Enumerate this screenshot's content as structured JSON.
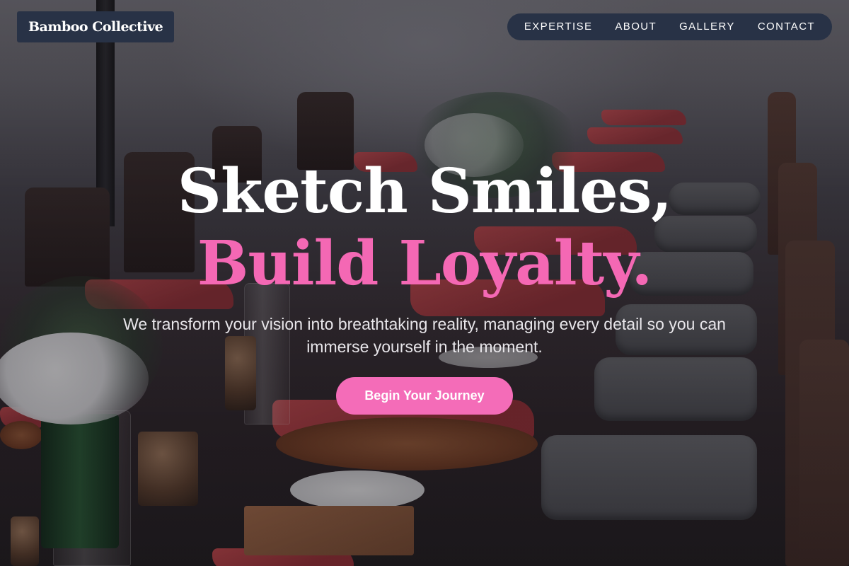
{
  "header": {
    "brand": "Bamboo Collective",
    "nav": {
      "items": [
        {
          "label": "EXPERTISE"
        },
        {
          "label": "ABOUT"
        },
        {
          "label": "GALLERY"
        },
        {
          "label": "CONTACT"
        }
      ]
    }
  },
  "hero": {
    "headline_line1": "Sketch Smiles,",
    "headline_line2": "Build Loyalty.",
    "subtitle": "We transform your vision into breathtaking reality, managing every detail so you can immerse yourself in the moment.",
    "cta_label": "Begin Your Journey",
    "background_image": "outdoor-banquet-table-photo"
  },
  "colors": {
    "accent_pink": "#f468b4",
    "button_pink": "#f46cb8",
    "navy": "#283246",
    "white": "#ffffff"
  }
}
